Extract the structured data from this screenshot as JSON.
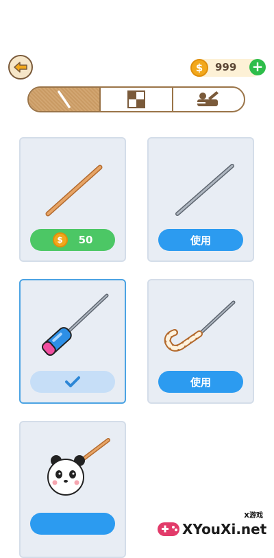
{
  "header": {
    "back_icon": "arrow-left-icon",
    "coins": "999",
    "coin_symbol": "$",
    "plus_symbol": "+"
  },
  "tabs": [
    {
      "icon": "stick-icon",
      "active": true
    },
    {
      "icon": "checkerboard-icon",
      "active": false
    },
    {
      "icon": "tools-icon",
      "active": false
    }
  ],
  "items": [
    {
      "name": "wooden-stick",
      "action": "buy",
      "price": "50",
      "coin_symbol": "$"
    },
    {
      "name": "metal-needle",
      "action": "use",
      "label": "使用"
    },
    {
      "name": "paintbrush-needle",
      "action": "equipped",
      "icon": "checkmark-icon"
    },
    {
      "name": "candy-cane-needle",
      "action": "use",
      "label": "使用"
    },
    {
      "name": "panda-stick",
      "action": "use"
    }
  ],
  "watermark": {
    "small": "X游戏",
    "brand": "XYouXi.net"
  },
  "colors": {
    "accent_brown": "#9a7448",
    "buy_green": "#4cc765",
    "use_blue": "#2c9bf0",
    "equipped_light_blue": "#c6def7",
    "card_bg": "#e8edf4",
    "coin_gold": "#f2a81c"
  }
}
